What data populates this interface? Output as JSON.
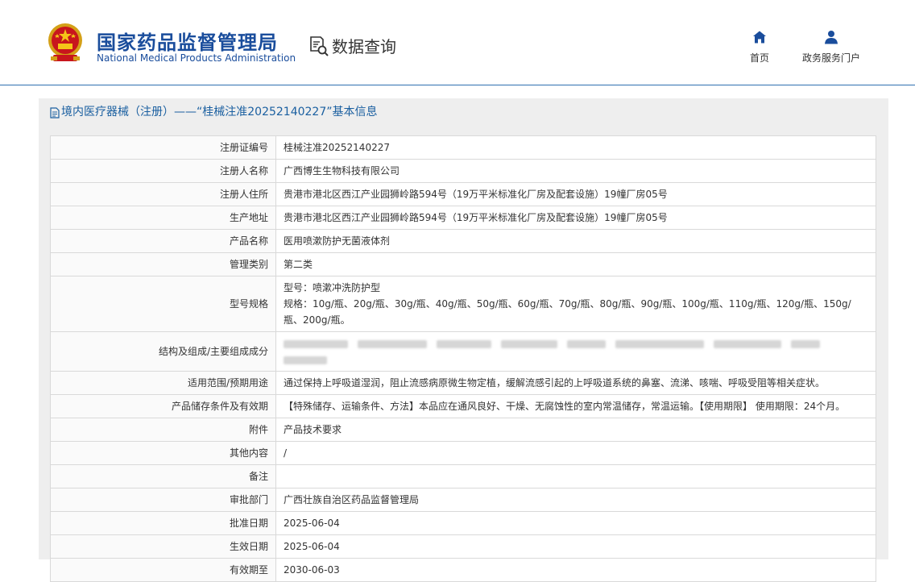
{
  "header": {
    "org_name_cn": "国家药品监督管理局",
    "org_name_en": "National Medical Products Administration",
    "section_title": "数据查询",
    "nav": [
      {
        "label": "首页",
        "icon": "home-icon"
      },
      {
        "label": "政务服务门户",
        "icon": "user-icon"
      }
    ]
  },
  "panel": {
    "title": "境内医疗器械（注册）——“桂械注准20252140227”基本信息"
  },
  "colors": {
    "brand_blue": "#1a4d9c",
    "link_blue": "#1a5fa0",
    "panel_bg": "#eeeeee",
    "border": "#d9d9d9"
  },
  "rows": [
    {
      "label": "注册证编号",
      "value": "桂械注准20252140227"
    },
    {
      "label": "注册人名称",
      "value": "广西博生生物科技有限公司"
    },
    {
      "label": "注册人住所",
      "value": "贵港市港北区西江产业园狮岭路594号（19万平米标准化厂房及配套设施）19幢厂房05号"
    },
    {
      "label": "生产地址",
      "value": "贵港市港北区西江产业园狮岭路594号（19万平米标准化厂房及配套设施）19幢厂房05号"
    },
    {
      "label": "产品名称",
      "value": "医用喷漱防护无菌液体剂"
    },
    {
      "label": "管理类别",
      "value": "第二类"
    },
    {
      "label": "型号规格",
      "value": "型号：喷漱冲洗防护型\n规格：10g/瓶、20g/瓶、30g/瓶、40g/瓶、50g/瓶、60g/瓶、70g/瓶、80g/瓶、90g/瓶、100g/瓶、110g/瓶、120g/瓶、150g/瓶、200g/瓶。"
    },
    {
      "label": "结构及组成/主要组成成分",
      "value": "",
      "redacted": true
    },
    {
      "label": "适用范围/预期用途",
      "value": "通过保持上呼吸道湿润，阻止流感病原微生物定植，缓解流感引起的上呼吸道系统的鼻塞、流涕、咳喘、呼吸受阻等相关症状。"
    },
    {
      "label": "产品储存条件及有效期",
      "value": "【特殊储存、运输条件、方法】本品应在通风良好、干燥、无腐蚀性的室内常温储存，常温运输。【使用期限】 使用期限：24个月。"
    },
    {
      "label": "附件",
      "value": "产品技术要求"
    },
    {
      "label": "其他内容",
      "value": "/"
    },
    {
      "label": "备注",
      "value": ""
    },
    {
      "label": "审批部门",
      "value": "广西壮族自治区药品监督管理局"
    },
    {
      "label": "批准日期",
      "value": "2025-06-04"
    },
    {
      "label": "生效日期",
      "value": "2025-06-04"
    },
    {
      "label": "有效期至",
      "value": "2030-06-03"
    }
  ]
}
